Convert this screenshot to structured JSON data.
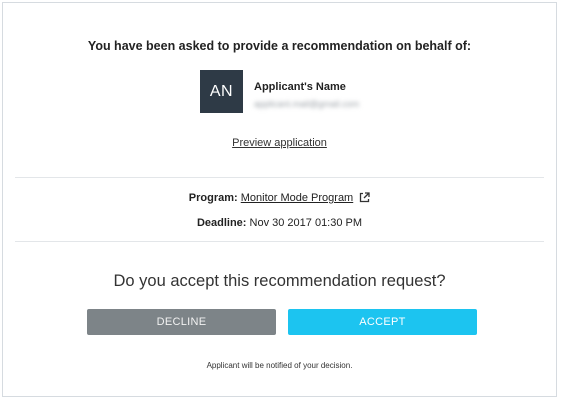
{
  "request": {
    "headline": "You have been asked to provide a recommendation on behalf of:",
    "avatar_initials": "AN",
    "applicant_name": "Applicant's Name",
    "applicant_email": "applicant.mail@gmail.com",
    "preview_label": "Preview application"
  },
  "details": {
    "program_label": "Program:",
    "program_name": "Monitor Mode Program",
    "program_icon": "external-link-icon",
    "deadline_label": "Deadline:",
    "deadline_value": "Nov 30 2017 01:30 PM"
  },
  "decision": {
    "question": "Do you accept this recommendation request?",
    "decline_label": "DECLINE",
    "accept_label": "ACCEPT",
    "note": "Applicant will be notified of your decision."
  },
  "colors": {
    "avatar_bg": "#2e3a46",
    "decline_bg": "#7d8488",
    "accept_bg": "#1cc4f0"
  }
}
